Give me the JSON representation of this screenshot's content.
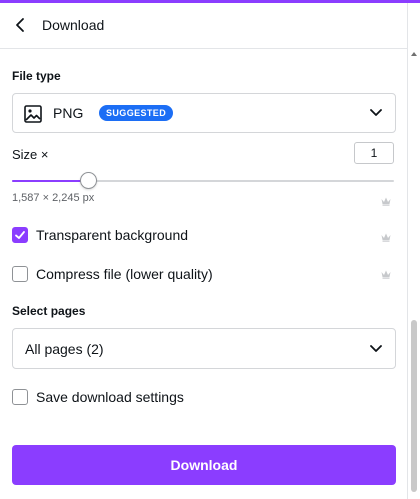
{
  "header": {
    "title": "Download"
  },
  "file_type": {
    "label": "File type",
    "value": "PNG",
    "badge": "SUGGESTED",
    "icon": "image-icon"
  },
  "size": {
    "label": "Size ×",
    "value": "1",
    "dimensions": "1,587 × 2,245 px",
    "slider_fraction": 0.2
  },
  "options": {
    "transparent_background": {
      "label": "Transparent background",
      "checked": true,
      "premium": true
    },
    "compress_file": {
      "label": "Compress file (lower quality)",
      "checked": false,
      "premium": true
    }
  },
  "pages": {
    "label": "Select pages",
    "value": "All pages (2)"
  },
  "save_settings": {
    "label": "Save download settings",
    "checked": false
  },
  "download_button": {
    "label": "Download"
  },
  "colors": {
    "accent": "#8b3dff",
    "badge": "#1c6ef5",
    "crown": "#c7c9cc"
  }
}
